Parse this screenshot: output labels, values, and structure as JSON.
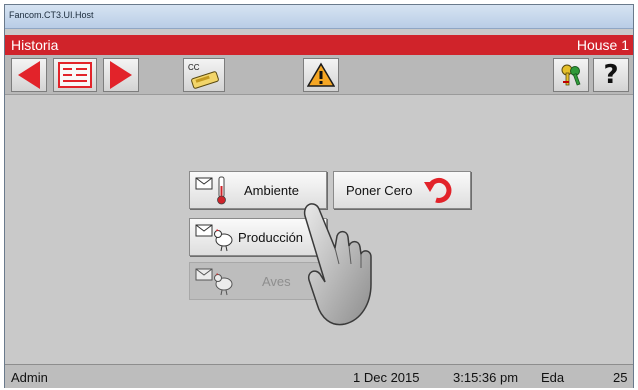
{
  "window": {
    "title": "Fancom.CT3.UI.Host"
  },
  "header": {
    "title": "Historia",
    "location": "House 1"
  },
  "toolbar": {
    "cc_label": "CC"
  },
  "menu": {
    "ambiente": "Ambiente",
    "poner_cero": "Poner Cero",
    "produccion": "Producción",
    "aves": "Aves"
  },
  "status": {
    "user": "Admin",
    "date": "1 Dec 2015",
    "time": "3:15:36 pm",
    "age_label": "Eda",
    "age_value": "25"
  },
  "colors": {
    "accent": "#d0232a",
    "warning": "#f5a623"
  }
}
